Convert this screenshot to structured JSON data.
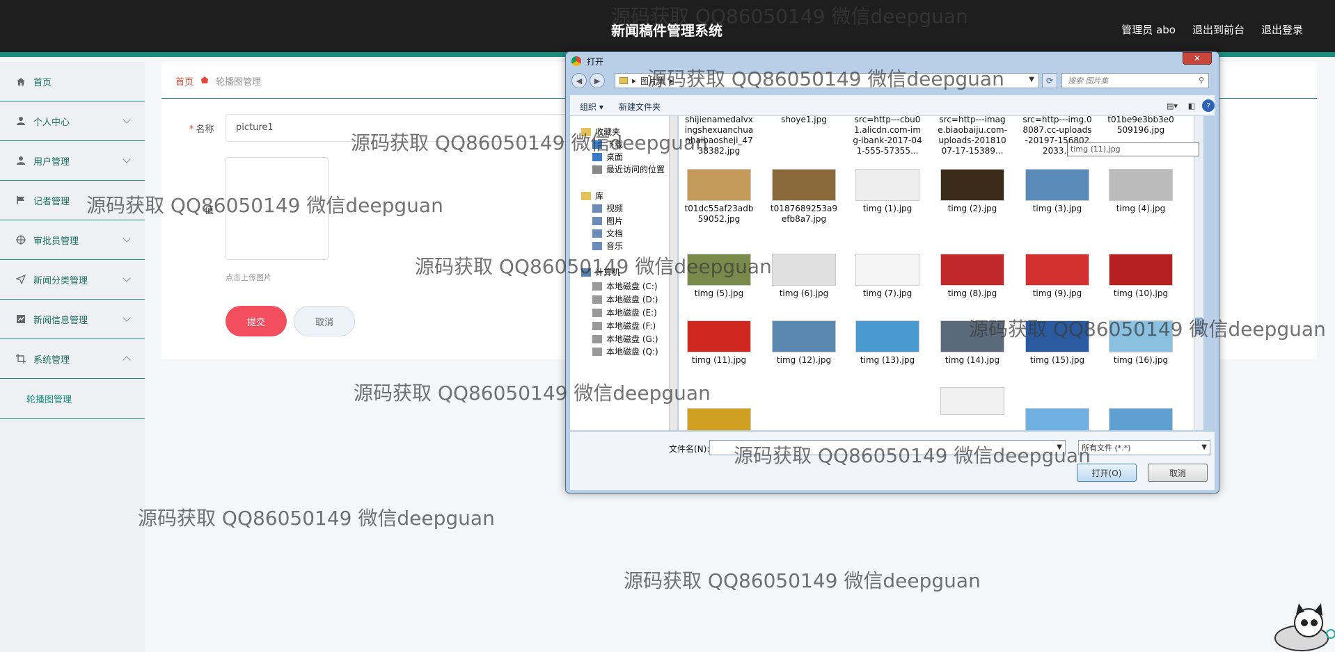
{
  "header": {
    "title": "新闻稿件管理系统",
    "admin": "管理员 abo",
    "back_front": "退出到前台",
    "logout": "退出登录"
  },
  "sidebar": {
    "items": [
      {
        "label": "首页",
        "icon": "home-icon"
      },
      {
        "label": "个人中心",
        "icon": "user-icon"
      },
      {
        "label": "用户管理",
        "icon": "users-icon"
      },
      {
        "label": "记者管理",
        "icon": "flag-icon"
      },
      {
        "label": "审批员管理",
        "icon": "target-icon"
      },
      {
        "label": "新闻分类管理",
        "icon": "send-icon"
      },
      {
        "label": "新闻信息管理",
        "icon": "chart-icon"
      },
      {
        "label": "系统管理",
        "icon": "crop-icon"
      }
    ],
    "sub_item": "轮播图管理"
  },
  "breadcrumb": {
    "home": "首页",
    "current": "轮播图管理"
  },
  "form": {
    "name_label": "名称",
    "name_value": "picture1",
    "image_label": "值",
    "upload_tip": "点击上传图片",
    "submit": "提交",
    "cancel": "取消"
  },
  "dialog": {
    "title": "打开",
    "close": "✕",
    "path": "图片集",
    "search_placeholder": "搜索 图片集",
    "organize": "组织 ▾",
    "new_folder": "新建文件夹",
    "nav": [
      "收藏夹",
      "下载",
      "桌面",
      "最近访问的位置",
      "库",
      "视频",
      "图片",
      "文档",
      "音乐",
      "计算机",
      "本地磁盘 (C:)",
      "本地磁盘 (D:)",
      "本地磁盘 (E:)",
      "本地磁盘 (F:)",
      "本地磁盘 (G:)",
      "本地磁盘 (Q:)"
    ],
    "files_row0": [
      "shijienamedalvxingshexuanchuanhaibaosheji_4738382.jpg",
      "shoye1.jpg",
      "src=http---cbu01.alicdn.com-img-ibank-2017-041-555-57355...",
      "src=http---image.biaobaiju.com-uploads-20181007-17-15389...",
      "src=http---img.08087.cc-uploads-20197-1568022033...",
      "t01be9e3bb3e0509196.jpg"
    ],
    "files_row1": [
      "t01dc55af23adb59052.jpg",
      "t0187689253a9efb8a7.jpg",
      "timg (1).jpg",
      "timg (2).jpg",
      "timg (3).jpg",
      "timg (4).jpg"
    ],
    "files_row2": [
      "timg (5).jpg",
      "timg (6).jpg",
      "timg (7).jpg",
      "timg (8).jpg",
      "timg (9).jpg",
      "timg (10).jpg"
    ],
    "files_row3": [
      "timg (11).jpg",
      "timg (12).jpg",
      "timg (13).jpg",
      "timg (14).jpg",
      "timg (15).jpg",
      "timg (16).jpg"
    ],
    "tooltip": "timg (11).jpg",
    "filename_label": "文件名(N):",
    "filetype": "所有文件 (*.*)",
    "open": "打开(O)",
    "cancel": "取消"
  },
  "watermark_text": "源码获取 QQ86050149 微信deepguan",
  "colors": {
    "accent": "#1a8f80",
    "submit": "#f24e5e",
    "header_bg": "#1e1e1e"
  }
}
